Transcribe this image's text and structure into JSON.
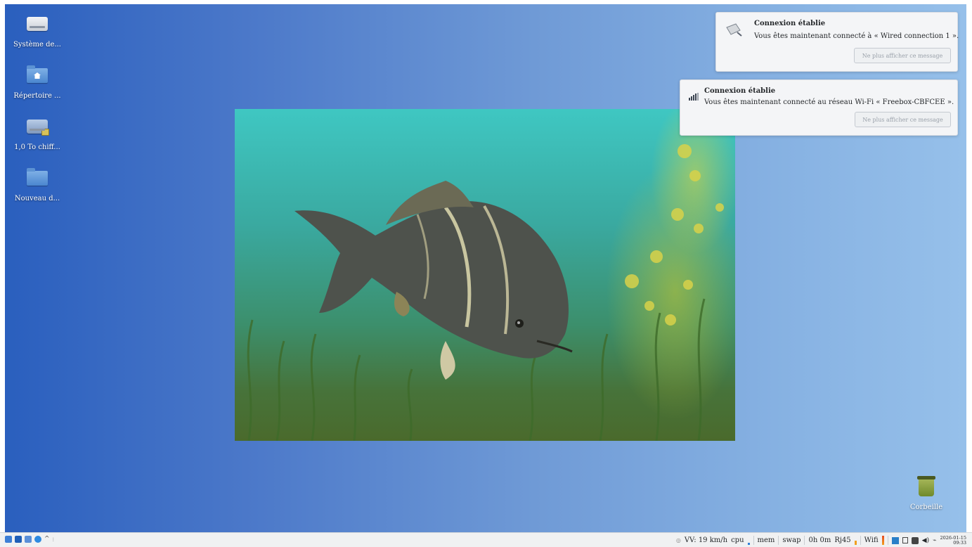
{
  "desktop": {
    "icons": [
      {
        "label": "Système de...",
        "icon": "hard-drive-icon"
      },
      {
        "label": "Répertoire ...",
        "icon": "home-folder-icon"
      },
      {
        "label": "1,0 To chiff...",
        "icon": "encrypted-drive-icon"
      },
      {
        "label": "Nouveau d...",
        "icon": "folder-icon"
      }
    ],
    "trash_label": "Corbeille",
    "wallpaper_subject": "carp-underwater-photo"
  },
  "notifications": [
    {
      "title": "Connexion établie",
      "body": "Vous êtes maintenant connecté à « Wired connection 1 ».",
      "button": "Ne plus afficher ce message",
      "icon": "ethernet-icon"
    },
    {
      "title": "Connexion établie",
      "body": "Vous êtes maintenant connecté au réseau Wi-Fi « Freebox-CBFCEE ».",
      "button": "Ne plus afficher ce message",
      "icon": "wifi-signal-icon"
    }
  ],
  "taskbar": {
    "speed": "VV: 19 km/h",
    "cpu": "cpu",
    "mem": "mem",
    "swap": "swap",
    "uptime": "0h 0m",
    "rj45": "Rj45",
    "wifi": "Wifi",
    "date": "2026-01-15",
    "time": "09:33",
    "colors": {
      "accent": "#3d9ee8",
      "cpu_bar": "#2f7fd8",
      "rj45_bar": "#f0a020",
      "wifi_bar": "#e84a20"
    }
  }
}
